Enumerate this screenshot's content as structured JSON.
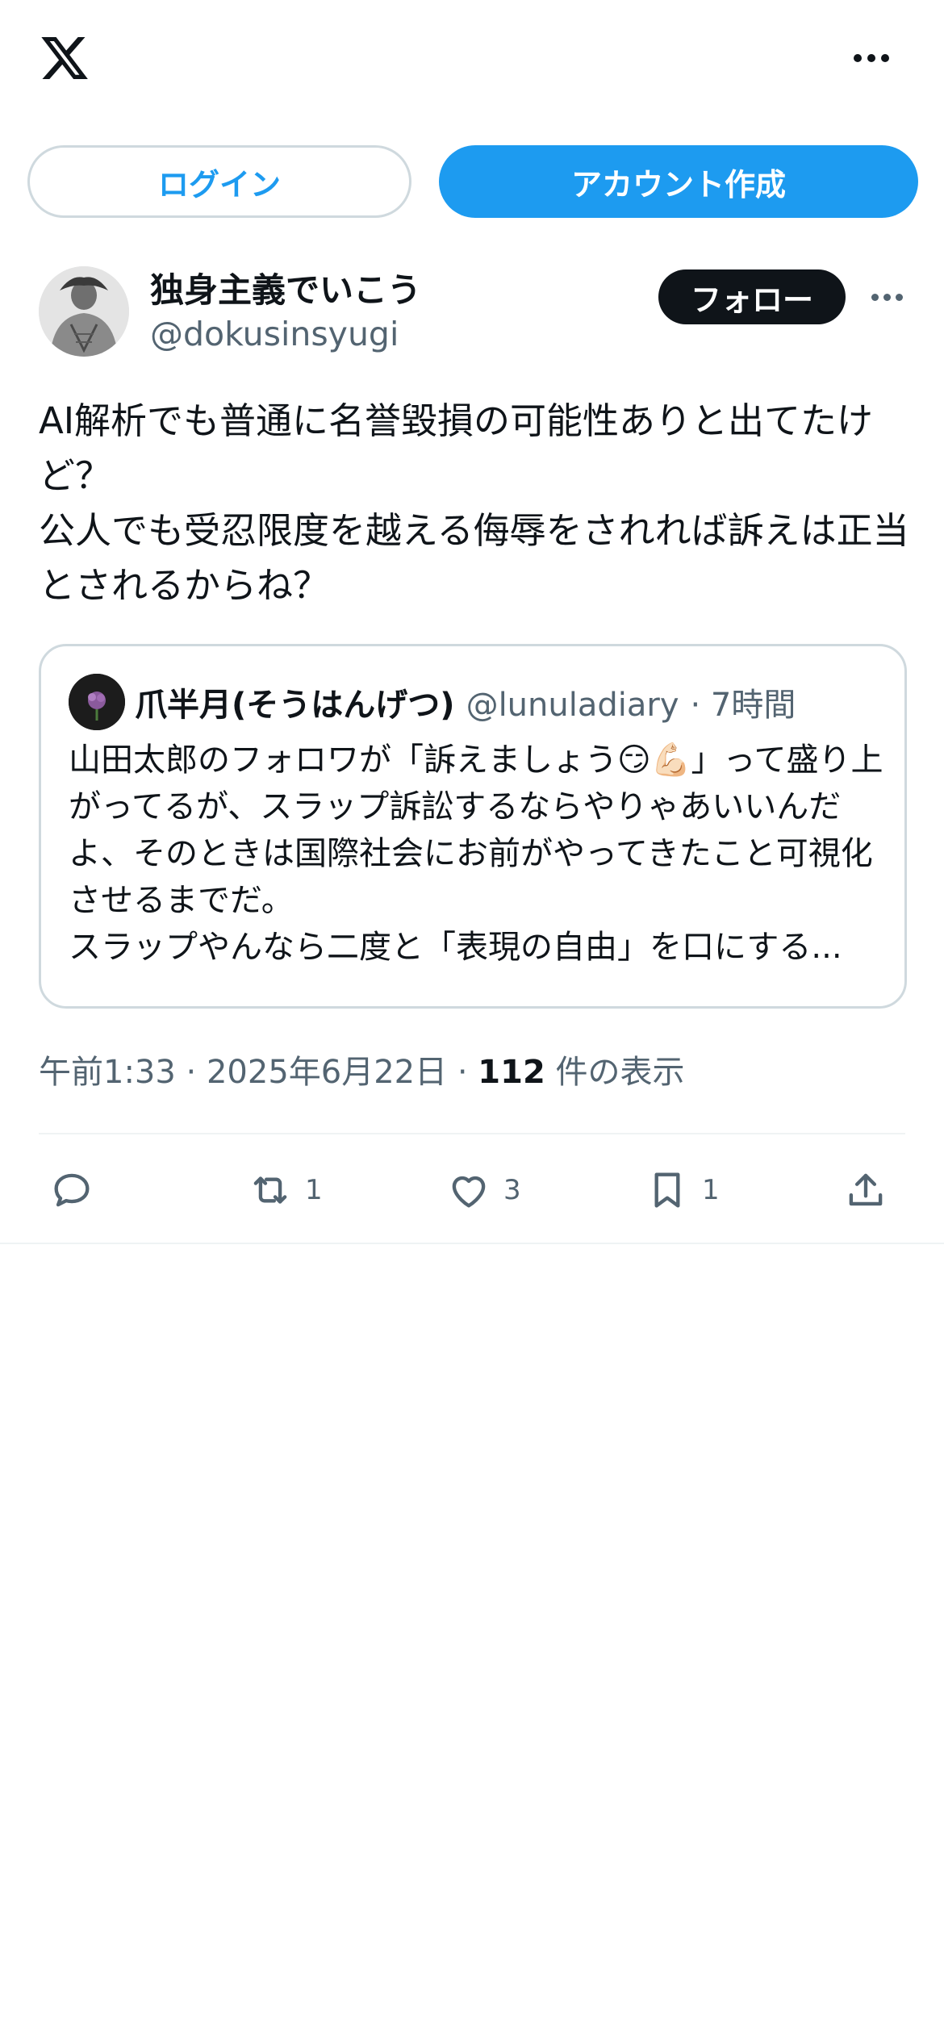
{
  "header": {
    "logo_icon": "x-logo-icon",
    "more_icon": "more-horizontal-icon"
  },
  "auth": {
    "login_label": "ログイン",
    "signup_label": "アカウント作成"
  },
  "tweet": {
    "author_name": "独身主義でいこう",
    "author_handle": "@dokusinsyugi",
    "follow_label": "フォロー",
    "text": "AI解析でも普通に名誉毀損の可能性ありと出てたけど？\n公人でも受忍限度を越える侮辱をされれば訴えは正当とされるからね？",
    "quote": {
      "author_name": "爪半月(そうはんげつ)",
      "author_handle": "@lunuladiary",
      "time": "· 7時間",
      "text": "山田太郎のフォロワが「訴えましょう😏💪🏻」って盛り上がってるが、スラップ訴訟するならやりゃあいいんだよ、そのときは国際社会にお前がやってきたこと可視化させるまでだ。\nスラップやんなら二度と「表現の自由」を口にする..."
    },
    "time": "午前1:33",
    "date": "2025年6月22日",
    "views_count": "112",
    "views_label": "件の表示",
    "actions": {
      "reply_count": "",
      "retweet_count": "1",
      "like_count": "3",
      "bookmark_count": "1"
    }
  },
  "colors": {
    "accent": "#1d9bf0",
    "text_primary": "#0f1419",
    "text_secondary": "#536471",
    "border": "#cfd9de"
  }
}
